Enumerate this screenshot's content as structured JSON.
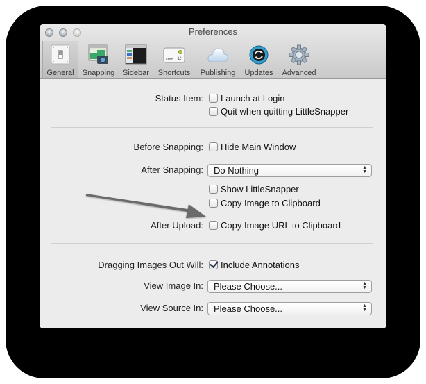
{
  "window": {
    "title": "Preferences",
    "traffic_lights": [
      "close",
      "minimize",
      "zoom"
    ]
  },
  "toolbar": {
    "selected": "General",
    "items": [
      {
        "label": "General",
        "icon": "light-switch-icon"
      },
      {
        "label": "Snapping",
        "icon": "camera-snapshot-icon"
      },
      {
        "label": "Sidebar",
        "icon": "sidebar-window-icon"
      },
      {
        "label": "Shortcuts",
        "icon": "keyboard-key-icon"
      },
      {
        "label": "Publishing",
        "icon": "cloud-icon"
      },
      {
        "label": "Updates",
        "icon": "refresh-icon"
      },
      {
        "label": "Advanced",
        "icon": "gear-icon"
      }
    ]
  },
  "status_item": {
    "label": "Status Item:",
    "options": [
      {
        "text": "Launch at Login",
        "checked": false
      },
      {
        "text": "Quit when quitting LittleSnapper",
        "checked": false
      }
    ]
  },
  "before_snapping": {
    "label": "Before Snapping:",
    "option": {
      "text": "Hide Main Window",
      "checked": false
    }
  },
  "after_snapping": {
    "label": "After Snapping:",
    "selected": "Do Nothing",
    "options": [
      {
        "text": "Show LittleSnapper",
        "checked": false
      },
      {
        "text": "Copy Image to Clipboard",
        "checked": false
      }
    ]
  },
  "after_upload": {
    "label": "After Upload:",
    "option": {
      "text": "Copy Image URL to Clipboard",
      "checked": false
    }
  },
  "dragging": {
    "label": "Dragging Images Out Will:",
    "option": {
      "text": "Include Annotations",
      "checked": true
    }
  },
  "view_image_in": {
    "label": "View Image In:",
    "selected": "Please Choose..."
  },
  "view_source_in": {
    "label": "View Source In:",
    "selected": "Please Choose..."
  },
  "annotation": {
    "type": "arrow",
    "points_to": "Copy Image URL to Clipboard",
    "color": "#6a6a6a"
  }
}
